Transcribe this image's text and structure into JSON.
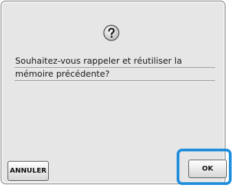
{
  "dialog": {
    "icon": "question-mark-icon",
    "message_lines": [
      "Souhaitez-vous rappeler et réutiliser la",
      "mémoire précédente?"
    ],
    "cancel_label": "ANNULER",
    "ok_label": "OK"
  },
  "colors": {
    "highlight": "#1e8ddd",
    "dialog_background": "#e6e6e6"
  }
}
